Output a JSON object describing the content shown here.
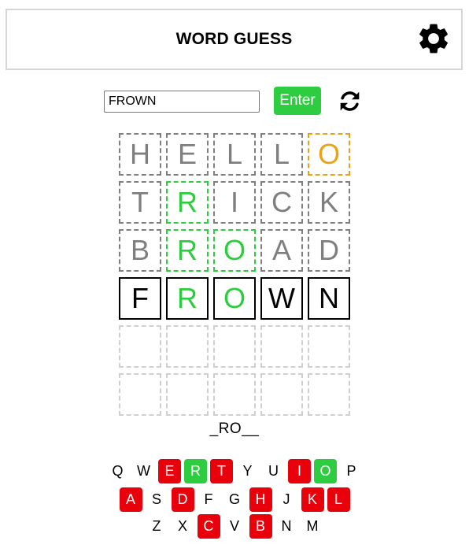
{
  "header": {
    "title": "WORD GUESS",
    "settings_icon": "gear-icon"
  },
  "input": {
    "value": "FROWN",
    "enter_label": "Enter",
    "refresh_icon": "refresh-icon"
  },
  "colors": {
    "correct": "#2ecc40",
    "present": "#e8a317",
    "absent": "#7f7f7f",
    "wrong_key": "#e8000b"
  },
  "board": {
    "rows": [
      {
        "letters": [
          "H",
          "E",
          "L",
          "L",
          "O"
        ],
        "states": [
          "absent",
          "absent",
          "absent",
          "absent",
          "present"
        ]
      },
      {
        "letters": [
          "T",
          "R",
          "I",
          "C",
          "K"
        ],
        "states": [
          "absent",
          "correct",
          "absent",
          "absent",
          "absent"
        ]
      },
      {
        "letters": [
          "B",
          "R",
          "O",
          "A",
          "D"
        ],
        "states": [
          "absent",
          "correct",
          "correct",
          "absent",
          "absent"
        ]
      },
      {
        "letters": [
          "F",
          "R",
          "O",
          "W",
          "N"
        ],
        "states": [
          "current",
          "current-correct",
          "current-correct",
          "current",
          "current"
        ]
      },
      {
        "letters": [
          "",
          "",
          "",
          "",
          ""
        ],
        "states": [
          "empty",
          "empty",
          "empty",
          "empty",
          "empty"
        ]
      },
      {
        "letters": [
          "",
          "",
          "",
          "",
          ""
        ],
        "states": [
          "empty",
          "empty",
          "empty",
          "empty",
          "empty"
        ]
      }
    ]
  },
  "pattern": "_RO__",
  "keyboard": {
    "rows": [
      [
        {
          "k": "Q",
          "s": "none"
        },
        {
          "k": "W",
          "s": "none"
        },
        {
          "k": "E",
          "s": "wrong"
        },
        {
          "k": "R",
          "s": "right"
        },
        {
          "k": "T",
          "s": "wrong"
        },
        {
          "k": "Y",
          "s": "none"
        },
        {
          "k": "U",
          "s": "none"
        },
        {
          "k": "I",
          "s": "wrong"
        },
        {
          "k": "O",
          "s": "right"
        },
        {
          "k": "P",
          "s": "none"
        }
      ],
      [
        {
          "k": "A",
          "s": "wrong"
        },
        {
          "k": "S",
          "s": "none"
        },
        {
          "k": "D",
          "s": "wrong"
        },
        {
          "k": "F",
          "s": "none"
        },
        {
          "k": "G",
          "s": "none"
        },
        {
          "k": "H",
          "s": "wrong"
        },
        {
          "k": "J",
          "s": "none"
        },
        {
          "k": "K",
          "s": "wrong"
        },
        {
          "k": "L",
          "s": "wrong"
        }
      ],
      [
        {
          "k": "Z",
          "s": "none"
        },
        {
          "k": "X",
          "s": "none"
        },
        {
          "k": "C",
          "s": "wrong"
        },
        {
          "k": "V",
          "s": "none"
        },
        {
          "k": "B",
          "s": "wrong"
        },
        {
          "k": "N",
          "s": "none"
        },
        {
          "k": "M",
          "s": "none"
        }
      ]
    ]
  }
}
